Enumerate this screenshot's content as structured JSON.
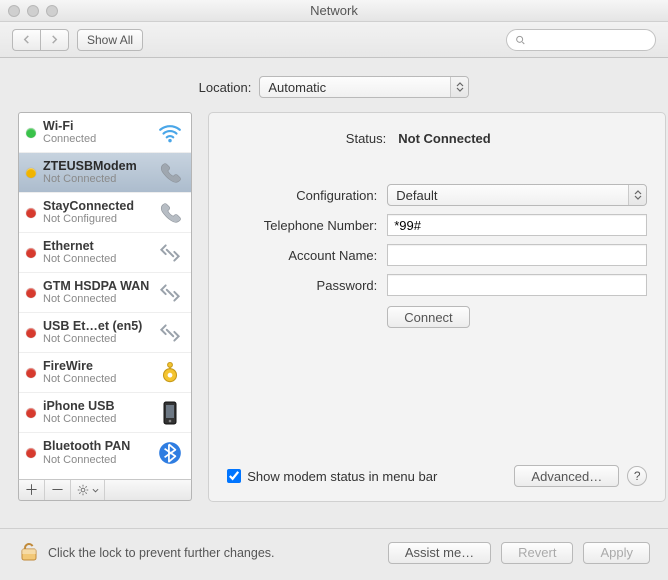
{
  "window": {
    "title": "Network"
  },
  "toolbar": {
    "show_all": "Show All",
    "search_placeholder": ""
  },
  "location": {
    "label": "Location:",
    "value": "Automatic"
  },
  "interfaces": [
    {
      "name": "Wi-Fi",
      "status": "Connected",
      "dot": "#39c24a",
      "icon": "wifi",
      "selected": false
    },
    {
      "name": "ZTEUSBModem",
      "status": "Not Connected",
      "dot": "#f0b400",
      "icon": "phone",
      "selected": true
    },
    {
      "name": "StayConnected",
      "status": "Not Configured",
      "dot": "#d63a2e",
      "icon": "phone-gray",
      "selected": false
    },
    {
      "name": "Ethernet",
      "status": "Not Connected",
      "dot": "#d63a2e",
      "icon": "ethernet",
      "selected": false
    },
    {
      "name": "GTM HSDPA WAN",
      "status": "Not Connected",
      "dot": "#d63a2e",
      "icon": "ethernet",
      "selected": false
    },
    {
      "name": "USB Et…et (en5)",
      "status": "Not Connected",
      "dot": "#d63a2e",
      "icon": "ethernet",
      "selected": false
    },
    {
      "name": "FireWire",
      "status": "Not Connected",
      "dot": "#d63a2e",
      "icon": "firewire",
      "selected": false
    },
    {
      "name": "iPhone USB",
      "status": "Not Connected",
      "dot": "#d63a2e",
      "icon": "iphone",
      "selected": false
    },
    {
      "name": "Bluetooth PAN",
      "status": "Not Connected",
      "dot": "#d63a2e",
      "icon": "bluetooth",
      "selected": false
    }
  ],
  "detail": {
    "status_label": "Status:",
    "status_value": "Not Connected",
    "config_label": "Configuration:",
    "config_value": "Default",
    "phone_label": "Telephone Number:",
    "phone_value": "*99#",
    "account_label": "Account Name:",
    "account_value": "",
    "password_label": "Password:",
    "password_value": "",
    "connect_button": "Connect",
    "show_modem_checkbox": "Show modem status in menu bar",
    "show_modem_checked": true,
    "advanced_button": "Advanced…"
  },
  "footer": {
    "lock_text": "Click the lock to prevent further changes.",
    "assist": "Assist me…",
    "revert": "Revert",
    "apply": "Apply"
  }
}
